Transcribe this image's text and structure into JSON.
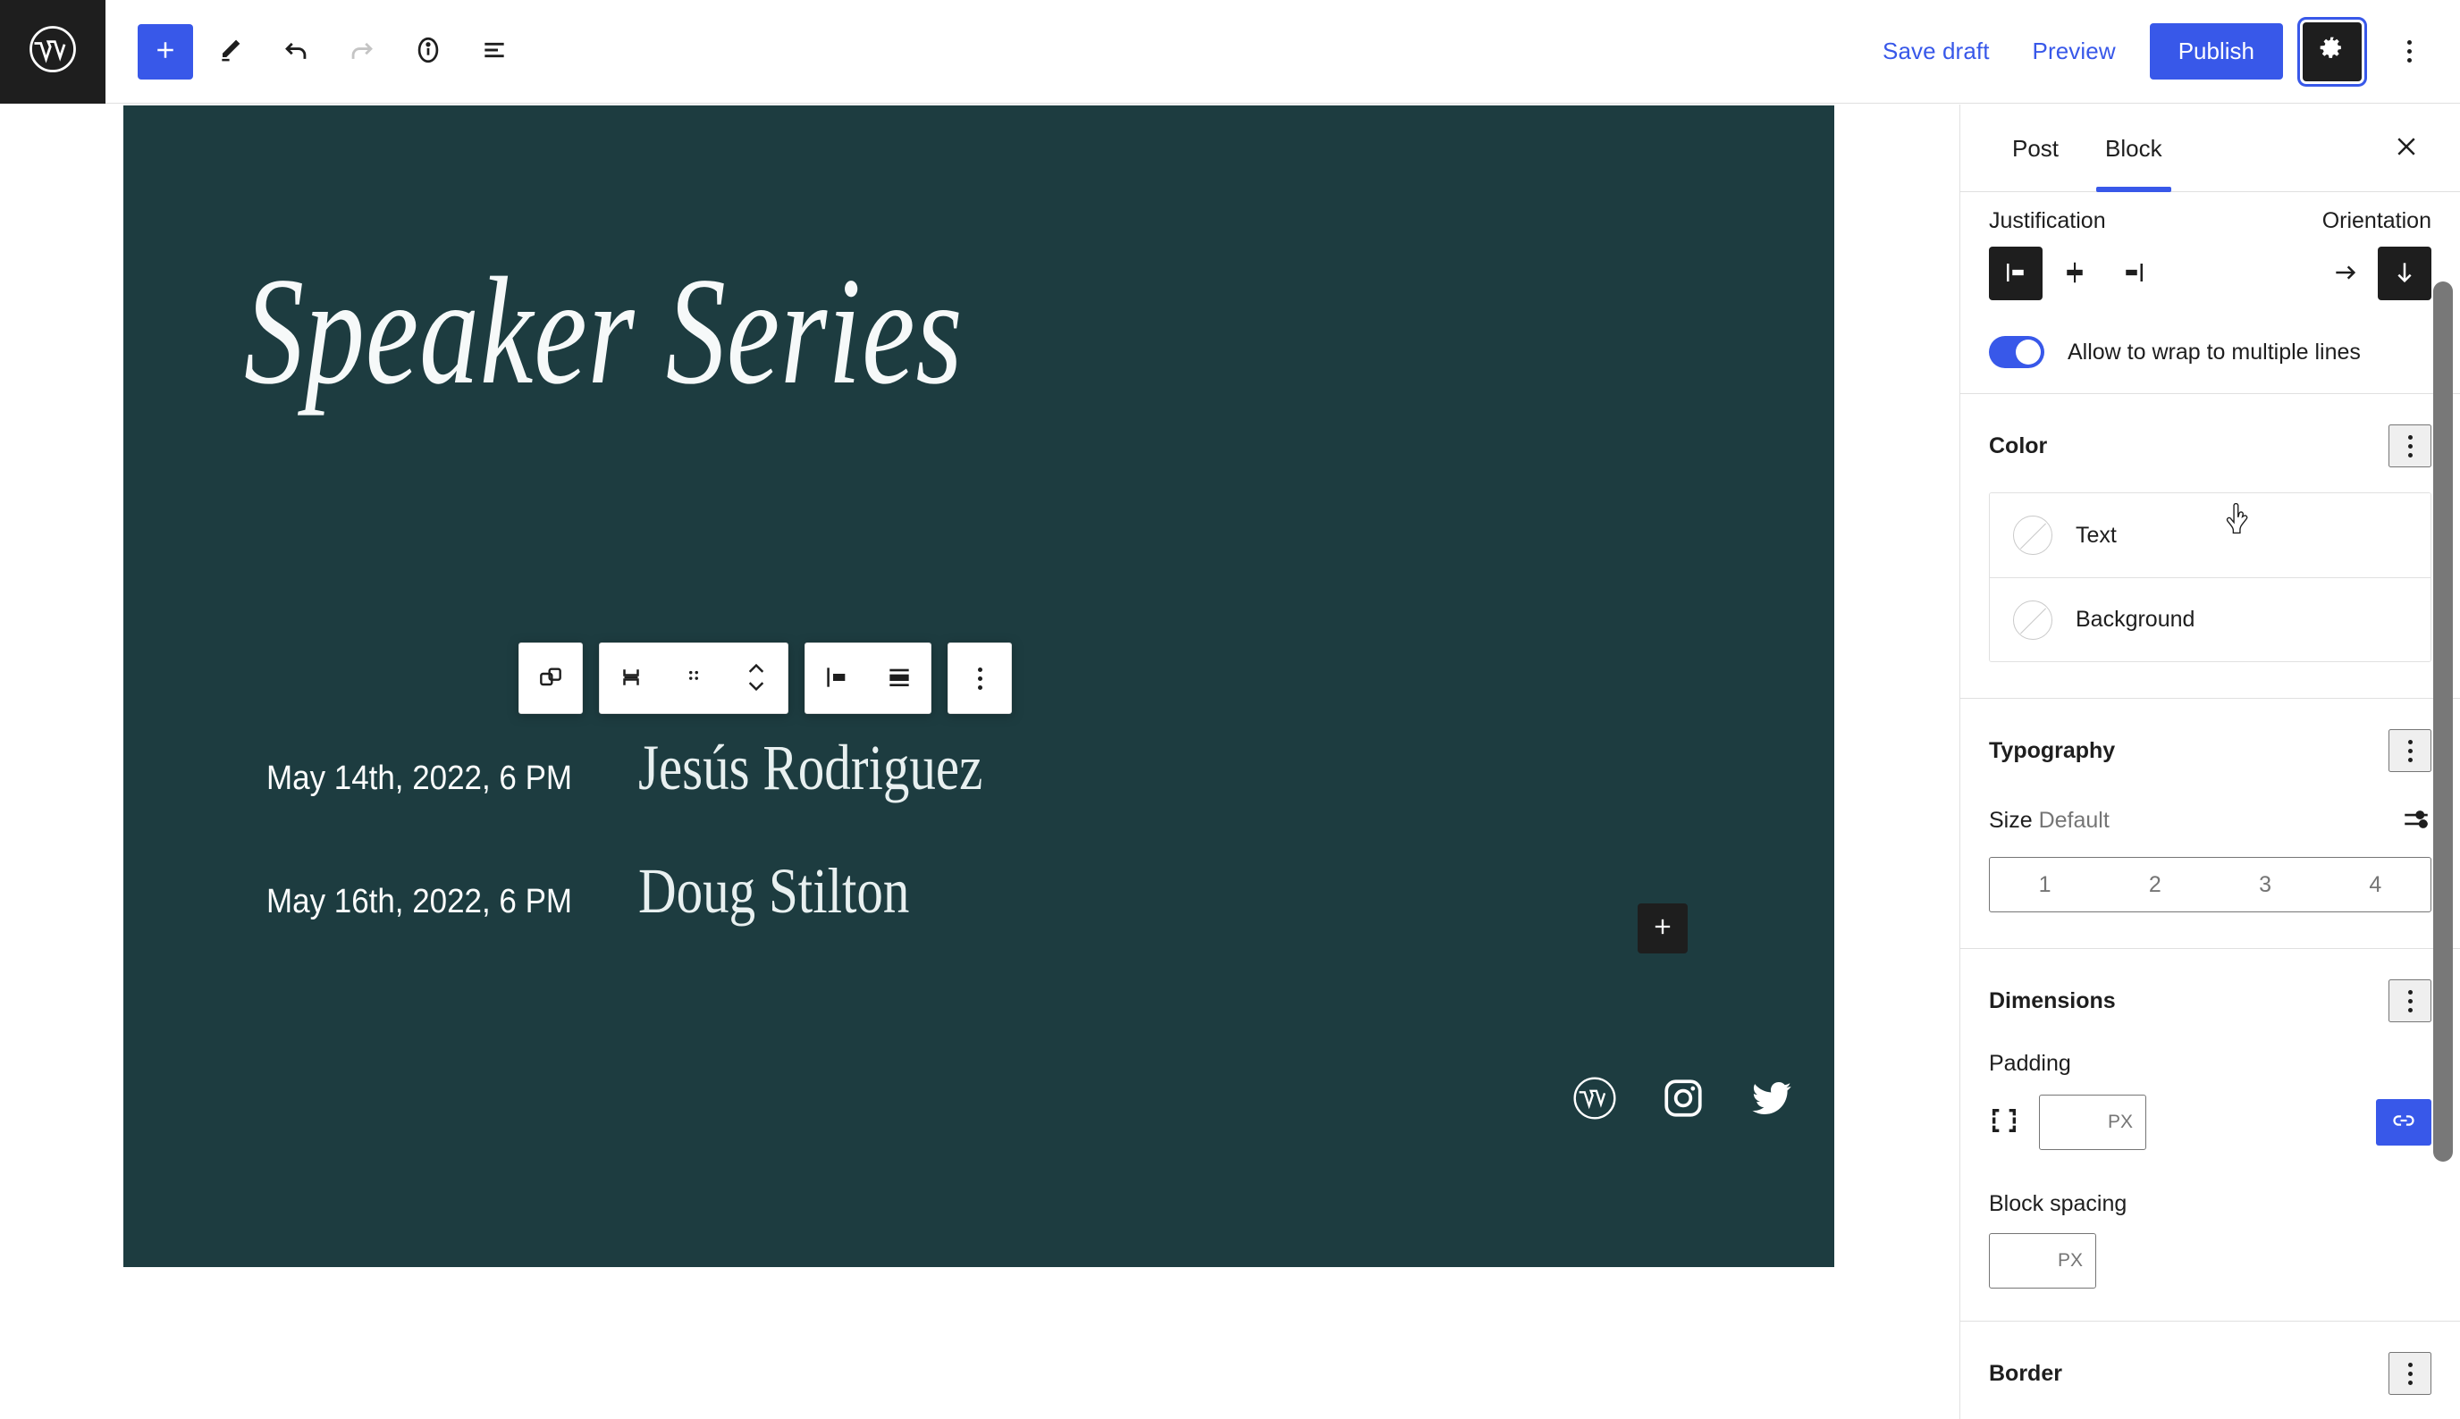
{
  "topbar": {
    "logo_icon": "wordpress-logo-icon",
    "tools": [
      {
        "name": "add-block-button",
        "icon": "plus-icon"
      },
      {
        "name": "edit-tool-button",
        "icon": "pencil-icon"
      },
      {
        "name": "undo-button",
        "icon": "undo-arrow-icon"
      },
      {
        "name": "redo-button",
        "icon": "redo-arrow-icon"
      },
      {
        "name": "details-button",
        "icon": "info-circle-icon"
      },
      {
        "name": "list-view-button",
        "icon": "list-view-icon"
      }
    ],
    "save_draft_label": "Save draft",
    "preview_label": "Preview",
    "publish_label": "Publish",
    "settings_icon": "gear-icon",
    "options_icon": "kebab-menu-icon"
  },
  "canvas": {
    "background_color": "#1d3c40",
    "title": "Speaker Series",
    "speakers": [
      {
        "date": "May 14th, 2022, 6 PM",
        "name": "Jesús Rodriguez"
      },
      {
        "date": "May 16th, 2022, 6 PM",
        "name": "Doug Stilton"
      }
    ],
    "social_icons": [
      "wordpress-icon",
      "instagram-icon",
      "twitter-icon"
    ],
    "add_block_icon": "plus-icon",
    "block_toolbar": [
      {
        "name": "block-type-button",
        "icon": "copy-blocks-icon"
      },
      {
        "name": "parent-block-button",
        "icon": "select-parent-icon"
      },
      {
        "name": "drag-handle-button",
        "icon": "drag-dots-icon"
      },
      {
        "name": "move-updown-button",
        "icon": "chevron-updown-icon"
      },
      {
        "name": "align-button",
        "icon": "align-left-icon"
      },
      {
        "name": "justify-button",
        "icon": "justify-icon"
      },
      {
        "name": "more-options-button",
        "icon": "kebab-menu-icon"
      }
    ]
  },
  "sidebar": {
    "tabs": [
      {
        "label": "Post",
        "active": false
      },
      {
        "label": "Block",
        "active": true
      }
    ],
    "close_icon": "close-icon",
    "layout": {
      "justification_label": "Justification",
      "orientation_label": "Orientation",
      "justification_options": [
        {
          "name": "justify-left",
          "icon": "justify-left-icon",
          "selected": true
        },
        {
          "name": "justify-center",
          "icon": "justify-center-icon",
          "selected": false
        },
        {
          "name": "justify-right",
          "icon": "justify-right-icon",
          "selected": false
        }
      ],
      "orientation_options": [
        {
          "name": "orientation-horizontal",
          "icon": "arrow-right-icon",
          "selected": false
        },
        {
          "name": "orientation-vertical",
          "icon": "arrow-down-icon",
          "selected": true
        }
      ],
      "wrap_toggle_label": "Allow to wrap to multiple lines",
      "wrap_toggle_on": true
    },
    "color": {
      "title": "Color",
      "options_icon": "kebab-menu-icon",
      "items": [
        {
          "label": "Text",
          "swatch": "none"
        },
        {
          "label": "Background",
          "swatch": "none"
        }
      ]
    },
    "typography": {
      "title": "Typography",
      "options_icon": "kebab-menu-icon",
      "size_label": "Size",
      "size_value": "Default",
      "size_toggle_icon": "sliders-icon",
      "size_presets": [
        "1",
        "2",
        "3",
        "4"
      ]
    },
    "dimensions": {
      "title": "Dimensions",
      "options_icon": "kebab-menu-icon",
      "padding_label": "Padding",
      "padding_icon": "padding-box-icon",
      "padding_value": "",
      "padding_unit": "PX",
      "link_sides_icon": "link-icon",
      "link_sides_active": true,
      "block_spacing_label": "Block spacing",
      "block_spacing_value": "",
      "block_spacing_unit": "PX"
    },
    "border": {
      "title": "Border",
      "options_icon": "kebab-menu-icon"
    }
  },
  "theme": {
    "accent": "#3858e9",
    "dark": "#1e1e1e",
    "canvas_bg": "#1d3c40"
  }
}
